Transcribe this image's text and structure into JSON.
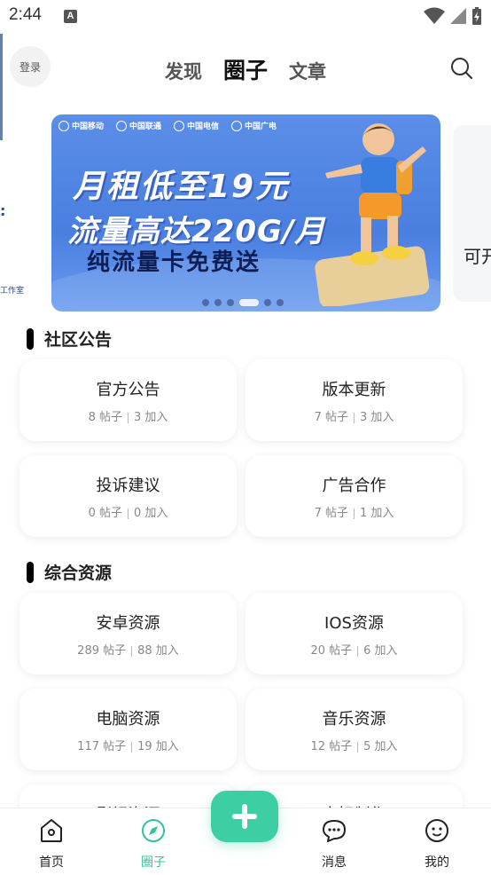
{
  "status_bar": {
    "time": "2:44",
    "notification_letter": "A"
  },
  "header": {
    "login_label": "登录",
    "tabs": [
      {
        "label": "发现",
        "active": false
      },
      {
        "label": "圈子",
        "active": true
      },
      {
        "label": "文章",
        "active": false
      }
    ]
  },
  "banner": {
    "logos": [
      "中国移动",
      "中国联通",
      "中国电信",
      "中国广电"
    ],
    "line1": "月租低至19元",
    "line2": "流量高达220G/月",
    "line3": "纯流量卡免费送",
    "dots_count": 6,
    "active_dot": 3,
    "next_card_text": "可开"
  },
  "edge_peek": {
    "text1": ":",
    "text2": "工作室"
  },
  "sections": [
    {
      "title": "社区公告",
      "cards": [
        {
          "title": "官方公告",
          "posts": "8 帖子",
          "joins": "3 加入"
        },
        {
          "title": "版本更新",
          "posts": "7 帖子",
          "joins": "3 加入"
        },
        {
          "title": "投诉建议",
          "posts": "0 帖子",
          "joins": "0 加入"
        },
        {
          "title": "广告合作",
          "posts": "7 帖子",
          "joins": "1 加入"
        }
      ]
    },
    {
      "title": "综合资源",
      "cards": [
        {
          "title": "安卓资源",
          "posts": "289 帖子",
          "joins": "88 加入"
        },
        {
          "title": "IOS资源",
          "posts": "20 帖子",
          "joins": "6 加入"
        },
        {
          "title": "电脑资源",
          "posts": "117 帖子",
          "joins": "19 加入"
        },
        {
          "title": "音乐资源",
          "posts": "12 帖子",
          "joins": "5 加入"
        },
        {
          "title": "影视资源",
          "posts": "",
          "joins": ""
        },
        {
          "title": "定好制作",
          "posts": "",
          "joins": ""
        }
      ]
    }
  ],
  "bottom_nav": [
    {
      "label": "首页",
      "icon": "home-icon",
      "active": false
    },
    {
      "label": "圈子",
      "icon": "compass-icon",
      "active": true
    },
    {
      "label": "消息",
      "icon": "chat-icon",
      "active": false
    },
    {
      "label": "我的",
      "icon": "profile-icon",
      "active": false
    }
  ],
  "colors": {
    "accent": "#3dcfa3",
    "active_nav": "#2fc39e",
    "banner_blue": "#4a7fe0"
  }
}
